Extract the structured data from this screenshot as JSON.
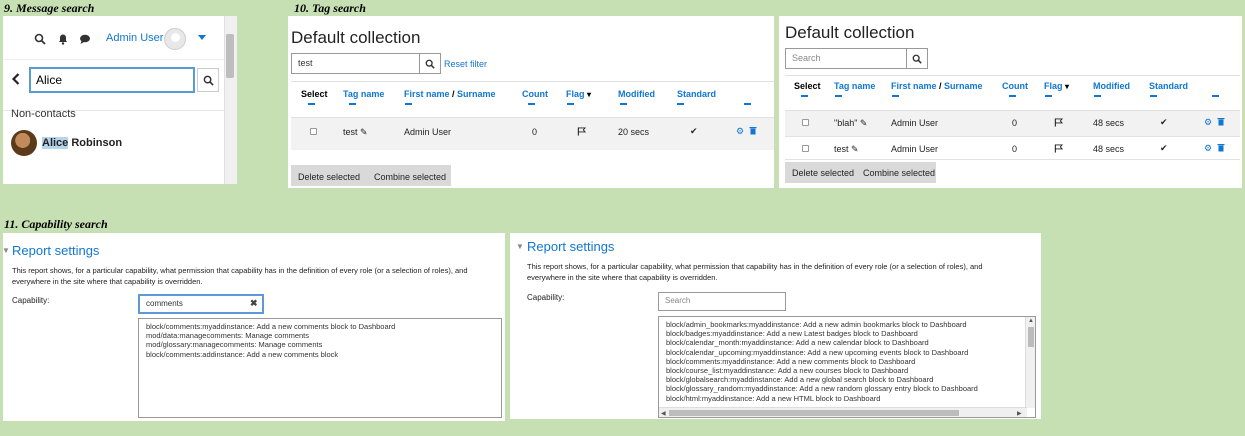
{
  "sections": {
    "message": "9. Message search",
    "tag": "10. Tag search",
    "capability": "11. Capability search"
  },
  "message_search": {
    "user_name": "Admin User",
    "input_value": "Alice",
    "group_label": "Non-contacts",
    "contact_match": "Alice",
    "contact_rest": " Robinson",
    "icons": [
      "search-icon",
      "bell-icon",
      "chat-icon",
      "caret-down-icon",
      "chevron-left-icon"
    ]
  },
  "tag_filtered": {
    "title": "Default collection",
    "filter_value": "test",
    "reset_label": "Reset filter",
    "headers": {
      "select": "Select",
      "tag_name": "Tag name",
      "first_name": "First name",
      "sep": " / ",
      "surname": "Surname",
      "count": "Count",
      "flag": "Flag",
      "modified": "Modified",
      "standard": "Standard"
    },
    "rows": [
      {
        "tag": "test",
        "user": "Admin User",
        "count": "0",
        "modified": "20 secs"
      }
    ],
    "delete_label": "Delete selected",
    "combine_label": "Combine selected"
  },
  "tag_all": {
    "title": "Default collection",
    "filter_placeholder": "Search",
    "headers": {
      "select": "Select",
      "tag_name": "Tag name",
      "first_name": "First name",
      "sep": " / ",
      "surname": "Surname",
      "count": "Count",
      "flag": "Flag",
      "modified": "Modified",
      "standard": "Standard"
    },
    "rows": [
      {
        "tag": "\"blah\"",
        "user": "Admin User",
        "count": "0",
        "modified": "48 secs"
      },
      {
        "tag": "test",
        "user": "Admin User",
        "count": "0",
        "modified": "48 secs"
      }
    ],
    "delete_label": "Delete selected",
    "combine_label": "Combine selected"
  },
  "capability_filtered": {
    "title": "Report settings",
    "description_1": "This report shows, for a particular capability, what permission that capability has in the definition of every role (or a selection of roles), and",
    "description_2": "everywhere in the site where that capability is overridden.",
    "capability_label": "Capability:",
    "input_value": "comments",
    "items": [
      "block/comments:myaddinstance: Add a new comments block to Dashboard",
      "mod/data:managecomments: Manage comments",
      "mod/glossary:managecomments: Manage comments",
      "block/comments:addinstance: Add a new comments block"
    ]
  },
  "capability_all": {
    "title": "Report settings",
    "description_1": "This report shows, for a particular capability, what permission that capability has in the definition of every role (or a selection of roles), and",
    "description_2": "everywhere in the site where that capability is overridden.",
    "capability_label": "Capability:",
    "input_placeholder": "Search",
    "items": [
      "block/admin_bookmarks:myaddinstance: Add a new admin bookmarks block to Dashboard",
      "block/badges:myaddinstance: Add a new Latest badges block to Dashboard",
      "block/calendar_month:myaddinstance: Add a new calendar block to Dashboard",
      "block/calendar_upcoming:myaddinstance: Add a new upcoming events block to Dashboard",
      "block/comments:myaddinstance: Add a new comments block to Dashboard",
      "block/course_list:myaddinstance: Add a new courses block to Dashboard",
      "block/globalsearch:myaddinstance: Add a new global search block to Dashboard",
      "block/glossary_random:myaddinstance: Add a new random glossary entry block to Dashboard",
      "block/html:myaddinstance: Add a new HTML block to Dashboard"
    ]
  },
  "colors": {
    "background": "#c6e0b4",
    "link": "#1177d1",
    "focus_border": "#5b9bd5"
  }
}
